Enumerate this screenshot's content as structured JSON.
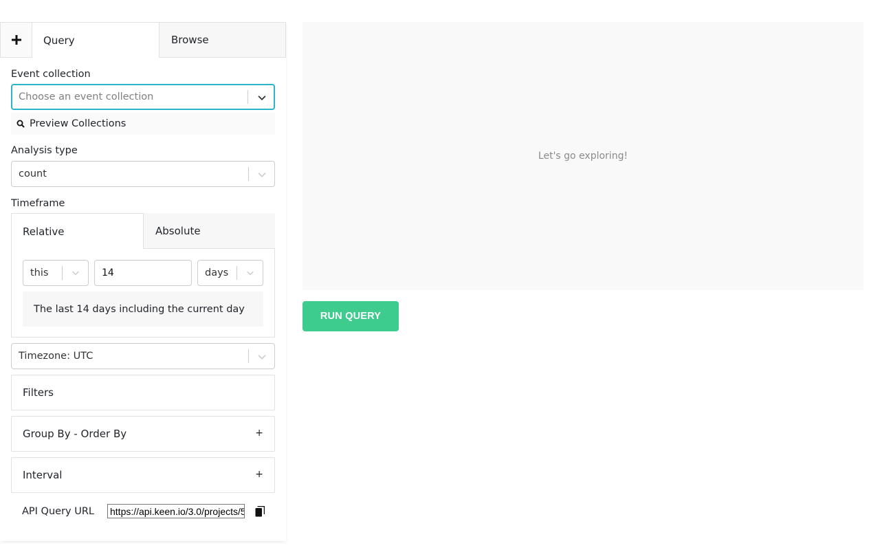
{
  "tabs": {
    "add_icon": "plus-icon",
    "query_label": "Query",
    "browse_label": "Browse"
  },
  "event_collection": {
    "label": "Event collection",
    "placeholder": "Choose an event collection",
    "preview_label": "Preview Collections"
  },
  "analysis_type": {
    "label": "Analysis type",
    "value": "count"
  },
  "timeframe": {
    "label": "Timeframe",
    "tab_relative": "Relative",
    "tab_absolute": "Absolute",
    "relativity": "this",
    "amount": "14",
    "units": "days",
    "description": "The last 14 days including the current day"
  },
  "timezone": {
    "value": "Timezone: UTC"
  },
  "sections": {
    "filters": "Filters",
    "group_by": "Group By - Order By",
    "interval": "Interval",
    "expand_symbol": "+"
  },
  "api_query": {
    "label": "API Query URL",
    "url": "https://api.keen.io/3.0/projects/5"
  },
  "visualization": {
    "empty_message": "Let's go exploring!"
  },
  "actions": {
    "run_query": "RUN QUERY"
  },
  "colors": {
    "accent_focus": "#2bb3c9",
    "run_button": "#3dcc8e"
  }
}
